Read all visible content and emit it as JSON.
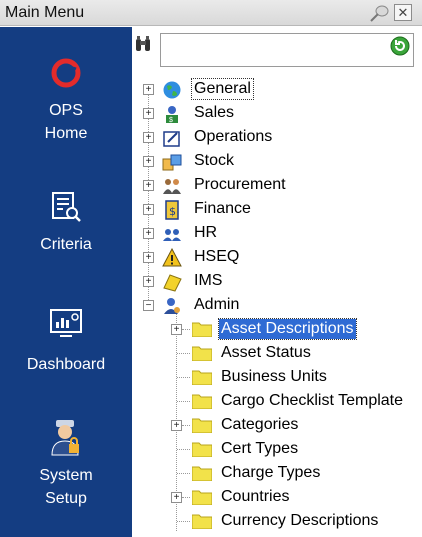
{
  "window": {
    "title": "Main Menu"
  },
  "left_nav": [
    {
      "label_line1": "OPS",
      "label_line2": "Home"
    },
    {
      "label_line1": "Criteria",
      "label_line2": ""
    },
    {
      "label_line1": "Dashboard",
      "label_line2": ""
    },
    {
      "label_line1": "System",
      "label_line2": "Setup"
    }
  ],
  "search": {
    "value": "",
    "placeholder": ""
  },
  "tree": {
    "top_level": [
      {
        "label": "General",
        "icon": "globe-icon"
      },
      {
        "label": "Sales",
        "icon": "sales-icon"
      },
      {
        "label": "Operations",
        "icon": "operations-icon"
      },
      {
        "label": "Stock",
        "icon": "stock-icon"
      },
      {
        "label": "Procurement",
        "icon": "procurement-icon"
      },
      {
        "label": "Finance",
        "icon": "finance-icon"
      },
      {
        "label": "HR",
        "icon": "hr-icon"
      },
      {
        "label": "HSEQ",
        "icon": "warning-icon"
      },
      {
        "label": "IMS",
        "icon": "ims-icon"
      },
      {
        "label": "Admin",
        "icon": "admin-icon"
      }
    ],
    "admin_children": [
      {
        "label": "Asset Descriptions",
        "expandable": true,
        "selected": true
      },
      {
        "label": "Asset Status",
        "expandable": false
      },
      {
        "label": "Business Units",
        "expandable": false
      },
      {
        "label": "Cargo Checklist Template",
        "expandable": false
      },
      {
        "label": "Categories",
        "expandable": true
      },
      {
        "label": "Cert Types",
        "expandable": false
      },
      {
        "label": "Charge Types",
        "expandable": false
      },
      {
        "label": "Countries",
        "expandable": true
      },
      {
        "label": "Currency Descriptions",
        "expandable": false
      }
    ]
  },
  "colors": {
    "nav_background": "#143d82",
    "selection": "#2f6bd4",
    "folder": "#f2e24a"
  }
}
